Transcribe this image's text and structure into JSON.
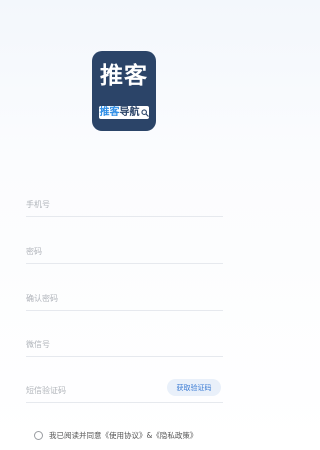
{
  "logo": {
    "main": "推客",
    "sub_part1": "推客",
    "sub_part2": "导航",
    "icon": "search-icon"
  },
  "form": {
    "phone_placeholder": "手机号",
    "password_placeholder": "密码",
    "confirm_password_placeholder": "确认密码",
    "wechat_placeholder": "微信号",
    "sms_code_placeholder": "短信验证码",
    "get_code_label": "获取验证码"
  },
  "agreement": {
    "prefix": "我已阅读并同意",
    "terms_link": "《使用协议》",
    "connector": "&",
    "privacy_link": "《隐私政策》"
  },
  "colors": {
    "brand_navy": "#2b4468",
    "accent_blue": "#3b7bd4"
  }
}
